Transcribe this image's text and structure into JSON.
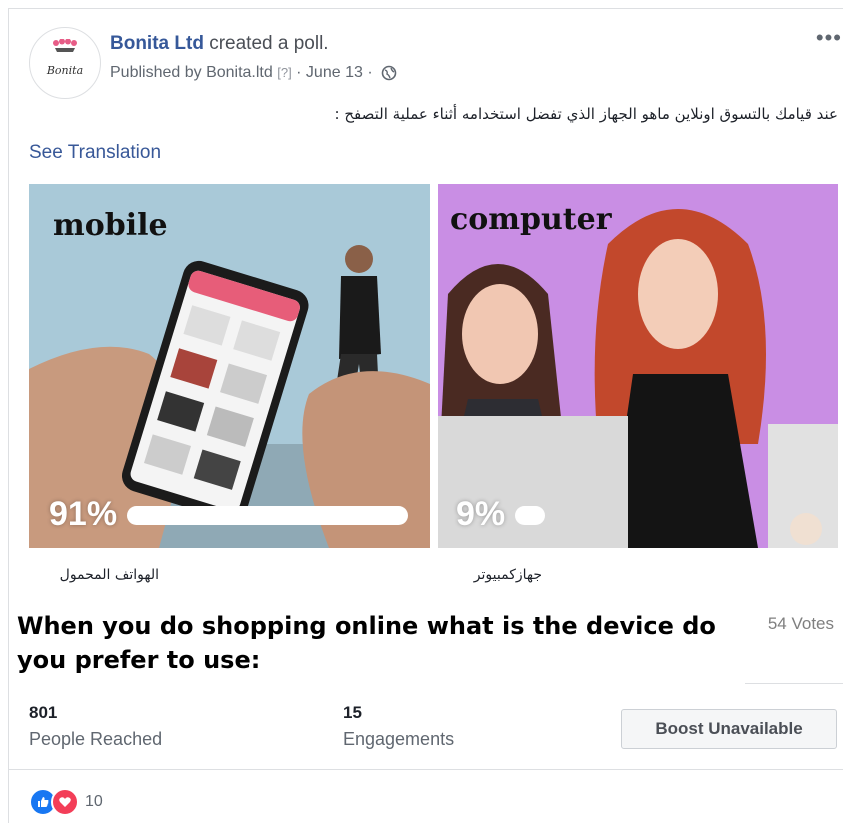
{
  "post": {
    "page_name": "Bonita Ltd",
    "action": "created a poll.",
    "published_by": "Published by Bonita.ltd",
    "help_marker": "[?]",
    "date": "· June 13 ·",
    "more_label": "•••",
    "body_text": "عند قيامك بالتسوق اونلاين ماهو الجهاز الذي تفضل استخدامه أثناء عملية التصفح :",
    "see_translation": "See Translation"
  },
  "avatar": {
    "logo_text": "Bonita"
  },
  "poll": {
    "question": "When you do shopping online what is the device do you prefer to use:",
    "votes": "54 Votes",
    "options": [
      {
        "label": "mobile",
        "percent_text": "91%",
        "percent": 91,
        "caption": "الهواتف المحمول"
      },
      {
        "label": "computer",
        "percent_text": "9%",
        "percent": 9,
        "caption": "جهازكمبيوتر"
      }
    ]
  },
  "insights": {
    "reached_count": "801",
    "reached_label": "People Reached",
    "engagements_count": "15",
    "engagements_label": "Engagements",
    "boost_label": "Boost Unavailable"
  },
  "reactions": {
    "count": "10",
    "icons": [
      "like-icon",
      "love-icon"
    ]
  },
  "colors": {
    "link": "#365899",
    "like": "#1877f2",
    "love": "#f33e58",
    "mobile_bg": "#a9c9d8",
    "computer_bg": "#c98ee4"
  }
}
